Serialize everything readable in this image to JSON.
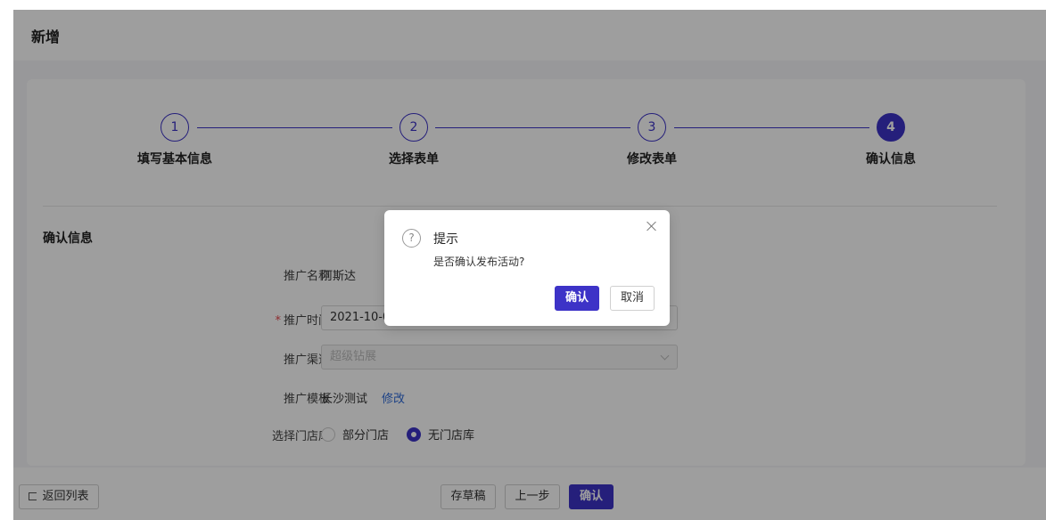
{
  "page": {
    "title": "新增"
  },
  "steps": [
    {
      "num": "1",
      "label": "填写基本信息"
    },
    {
      "num": "2",
      "label": "选择表单"
    },
    {
      "num": "3",
      "label": "修改表单"
    },
    {
      "num": "4",
      "label": "确认信息"
    }
  ],
  "section": {
    "title": "确认信息"
  },
  "form": {
    "name": {
      "label": "推广名称",
      "value": "阿斯达"
    },
    "time": {
      "label": "推广时间",
      "required_mark": "*",
      "value": "2021-10-04"
    },
    "channel": {
      "label": "推广渠道",
      "placeholder": "超级钻展"
    },
    "template": {
      "label": "推广模板",
      "value": "长沙测试",
      "link": "修改"
    },
    "store": {
      "label": "选择门店库",
      "options": [
        "部分门店",
        "无门店库"
      ],
      "selected": "无门店库"
    }
  },
  "footer": {
    "back_label": "返回列表",
    "draft_label": "存草稿",
    "prev_label": "上一步",
    "confirm_label": "确认"
  },
  "modal": {
    "icon": "question-icon",
    "icon_glyph": "?",
    "title": "提示",
    "message": "是否确认发布活动?",
    "ok_label": "确认",
    "cancel_label": "取消"
  },
  "colors": {
    "accent": "#3d33c7",
    "link": "#2f6bd8",
    "required": "#e5484d"
  }
}
